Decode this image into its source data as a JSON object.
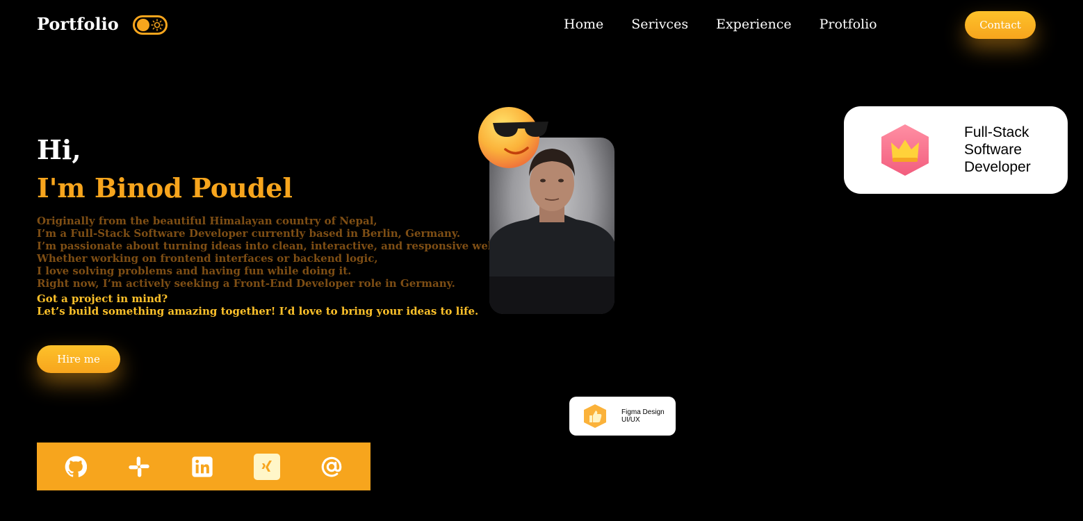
{
  "header": {
    "logo": "Portfolio",
    "nav": [
      "Home",
      "Serivces",
      "Experience",
      "Protfolio"
    ],
    "contact_label": "Contact"
  },
  "hero": {
    "greeting": "Hi,",
    "name": "I'm Binod Poudel",
    "bio_lines": [
      "Originally from the beautiful Himalayan country of Nepal,",
      "I’m a Full-Stack Software Developer currently based in Berlin, Germany.",
      "I’m passionate about turning ideas into clean, interactive, and responsive web applications.",
      "Whether working on frontend interfaces or backend logic,",
      "I love solving problems and having fun while doing it.",
      "Right now, I’m actively seeking a Front-End Developer role in Germany."
    ],
    "cta_lines": [
      "Got a project in mind?",
      "Let’s build something amazing together! I’d love to bring your ideas to life."
    ],
    "hire_label": "Hire me"
  },
  "cards": {
    "role_lines": [
      "Full-Stack",
      "Software",
      "Developer"
    ],
    "skill_lines": [
      "Figma Design",
      "UI/UX"
    ]
  },
  "social_icons": [
    "github-icon",
    "slack-icon",
    "linkedin-icon",
    "xing-icon",
    "email-at-icon"
  ],
  "colors": {
    "accent": "#f7a51d",
    "accent_light": "#fdc12a",
    "background": "#000000",
    "bio_text": "#7e4e14"
  }
}
